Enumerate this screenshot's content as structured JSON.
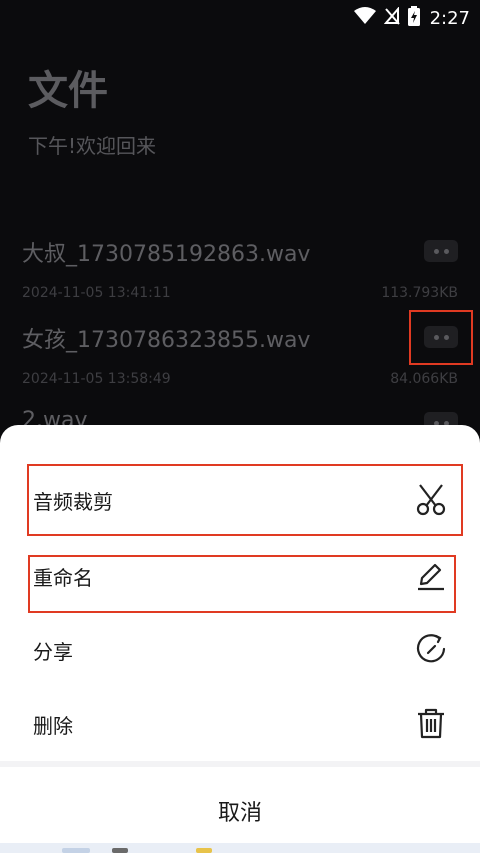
{
  "status_bar": {
    "time": "2:27"
  },
  "app": {
    "title": "文件",
    "subtitle": "下午!欢迎回来",
    "files": [
      {
        "name": "大叔_1730785192863.wav",
        "date": "2024-11-05 13:41:11",
        "size": "113.793KB"
      },
      {
        "name": "女孩_1730786323855.wav",
        "date": "2024-11-05 13:58:49",
        "size": "84.066KB"
      },
      {
        "name": "2.wav",
        "date": "",
        "size": ""
      }
    ]
  },
  "sheet": {
    "items": [
      {
        "label": "音频裁剪",
        "icon": "scissors-icon"
      },
      {
        "label": "重命名",
        "icon": "pencil-icon"
      },
      {
        "label": "分享",
        "icon": "share-icon"
      },
      {
        "label": "删除",
        "icon": "trash-icon"
      }
    ],
    "cancel_label": "取消"
  },
  "colors": {
    "highlight": "#e03a22",
    "background": "#0b0b0d",
    "sheet": "#ffffff"
  }
}
